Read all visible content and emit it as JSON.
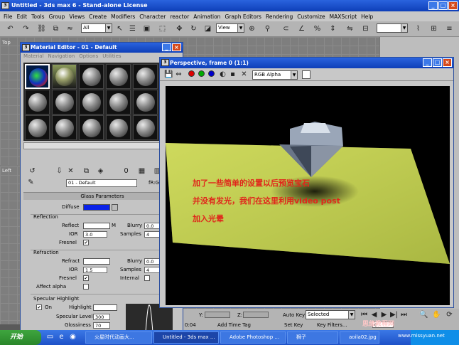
{
  "main_window": {
    "title": "Untitled - 3ds max 6 - Stand-alone License"
  },
  "menu": [
    "File",
    "Edit",
    "Tools",
    "Group",
    "Views",
    "Create",
    "Modifiers",
    "Character",
    "reactor",
    "Animation",
    "Graph Editors",
    "Rendering",
    "Customize",
    "MAXScript",
    "Help"
  ],
  "toolbar": {
    "selection_filter": "All",
    "ref_coord": "View"
  },
  "viewport_labels": {
    "top": "Top",
    "left": "Left"
  },
  "material_editor": {
    "title": "Material Editor - 01 - Default",
    "menu": [
      "Material",
      "Navigation",
      "Options",
      "Utilities"
    ],
    "material_name": "01 - Default",
    "material_type": "fR:Gla",
    "rollout": "Glass Parameters",
    "diffuse_label": "Diffuse",
    "reflection": {
      "group": "Reflection",
      "reflect_label": "Reflect",
      "map_marker": "M",
      "blurry_label": "Blurry",
      "blurry": "0.0",
      "ior_label": "IOR",
      "ior": "3.0",
      "samples_label": "Samples",
      "samples": "4",
      "fresnel_label": "Fresnel"
    },
    "refraction": {
      "group": "Refraction",
      "refract_label": "Refract",
      "blurry_label": "Blurry",
      "blurry": "0.0",
      "ior_label": "IOR",
      "ior": "1.5",
      "samples_label": "Samples",
      "samples": "4",
      "fresnel_label": "Fresnel",
      "internal_label": "Internal",
      "affect_alpha_label": "Affect alpha"
    },
    "specular": {
      "group": "Specular Highlight",
      "on_label": "On",
      "highlight_label": "Highlight",
      "level_label": "Specular Level",
      "level": "300",
      "gloss_label": "Glossiness",
      "gloss": "70"
    },
    "colors": {
      "diffuse": "#0a22e8",
      "reflect": "#ffffff",
      "refract": "#ffffff",
      "highlight": "#ffffff"
    }
  },
  "perspective_window": {
    "title": "Perspective, frame 0 (1:1)",
    "channel": "RGB Alpha",
    "annotation_lines": [
      "加了一些简单的设置以后预览宝石",
      "并没有发光，我们在这里利用video post",
      "加入光晕"
    ]
  },
  "status": {
    "y_label": "Y:",
    "z_label": "Z:",
    "auto_key": "Auto Key",
    "selected": "Selected",
    "set_key": "Set Key",
    "key_filters": "Key Filters...",
    "add_time_tag": "Add Time Tag",
    "time": "0:04",
    "frame": "0"
  },
  "taskbar": {
    "start": "开始",
    "tasks": [
      "火星时代动画大...",
      "Untitled - 3ds max ...",
      "Adobe Photoshop ...",
      "狮子",
      "aoila02.jpg"
    ],
    "tray_time": "思缘教程网"
  },
  "watermark": {
    "site_cn": "思缘教程网",
    "site_url": "www.missyuan.net"
  }
}
